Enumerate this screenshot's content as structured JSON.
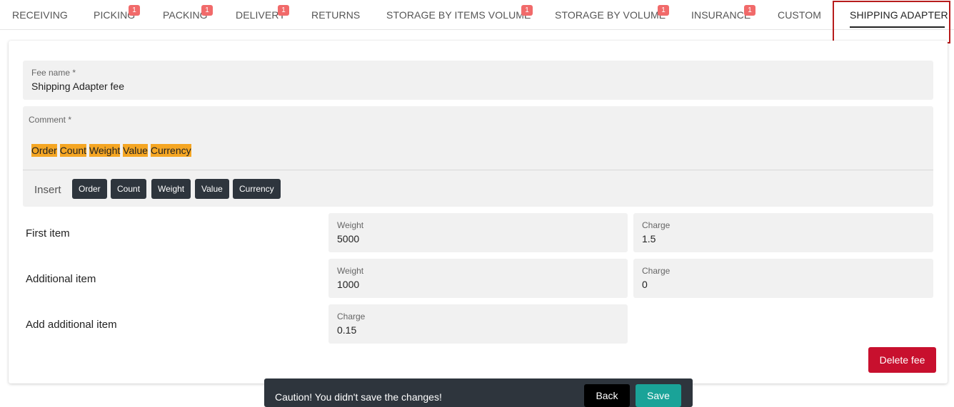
{
  "tabs": [
    {
      "label": "RECEIVING",
      "badge": ""
    },
    {
      "label": "PICKING",
      "badge": "1"
    },
    {
      "label": "PACKING",
      "badge": "1"
    },
    {
      "label": "DELIVERY",
      "badge": "1"
    },
    {
      "label": "RETURNS",
      "badge": ""
    },
    {
      "label": "STORAGE BY ITEMS VOLUME",
      "badge": "1"
    },
    {
      "label": "STORAGE BY VOLUME",
      "badge": "1"
    },
    {
      "label": "INSURANCE",
      "badge": "1"
    },
    {
      "label": "CUSTOM",
      "badge": ""
    },
    {
      "label": "SHIPPING ADAPTER",
      "badge": ""
    }
  ],
  "active_tab": "SHIPPING ADAPTER",
  "annotation_color": "#b71c1c",
  "fee_name": {
    "label": "Fee name *",
    "value": "Shipping Adapter fee"
  },
  "comment": {
    "label": "Comment *",
    "tokens": [
      "Order",
      "Count",
      "Weight",
      "Value",
      "Currency"
    ],
    "insert_label": "Insert",
    "insert_chips": [
      "Order",
      "Count",
      "Weight",
      "Value",
      "Currency"
    ]
  },
  "rows": {
    "first_item": {
      "label": "First item",
      "weight": {
        "label": "Weight",
        "value": "5000"
      },
      "charge": {
        "label": "Charge",
        "value": "1.5"
      }
    },
    "additional_item": {
      "label": "Additional item",
      "weight": {
        "label": "Weight",
        "value": "1000"
      },
      "charge": {
        "label": "Charge",
        "value": "0"
      }
    },
    "add_additional_item": {
      "label": "Add additional item",
      "charge": {
        "label": "Charge",
        "value": "0.15"
      }
    }
  },
  "delete_button": "Delete fee",
  "snackbar": {
    "message": "Caution! You didn't save the changes!",
    "back_label": "Back",
    "save_label": "Save"
  },
  "colors": {
    "token_highlight": "#f5a623",
    "delete": "#c8102e",
    "save": "#1aa398",
    "badge": "#f16a6a"
  }
}
